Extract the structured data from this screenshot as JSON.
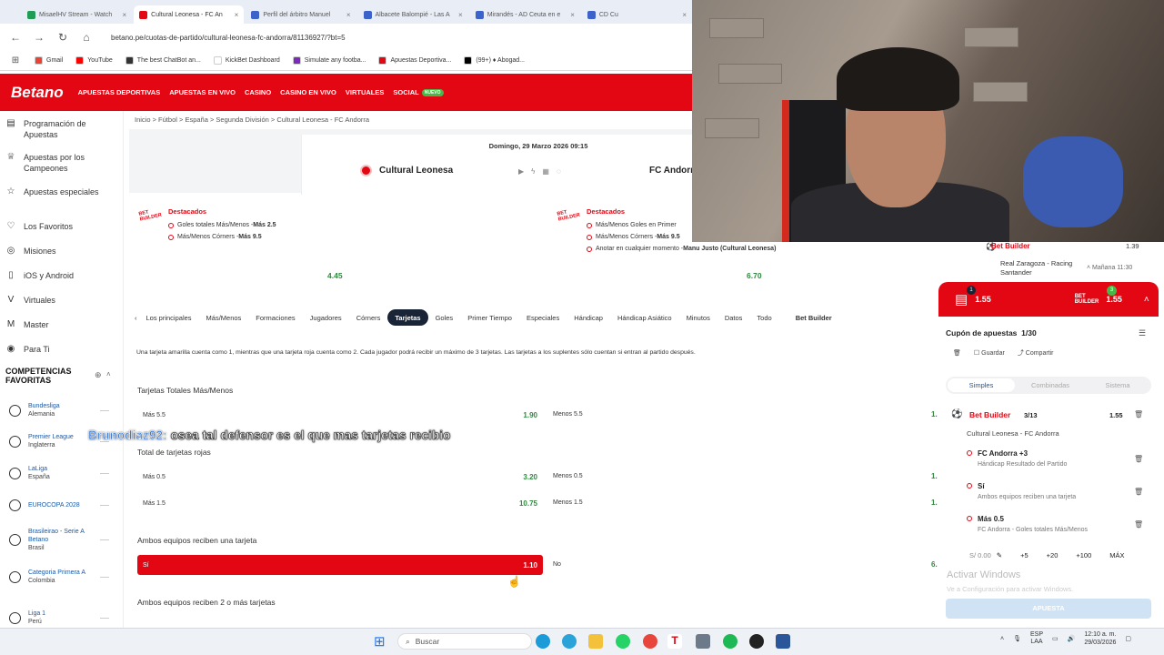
{
  "browser": {
    "tabs": [
      {
        "label": "MisaelHV Stream - Watch",
        "color": "#1f9d55"
      },
      {
        "label": "Cultural Leonesa - FC An",
        "color": "#e30613",
        "active": true
      },
      {
        "label": "Perfil del árbitro Manuel",
        "color": "#3b63c9"
      },
      {
        "label": "Albacete Balompié - Las A",
        "color": "#3b63c9"
      },
      {
        "label": "Mirandés - AD Ceuta en e",
        "color": "#3b63c9"
      },
      {
        "label": "CD Cu",
        "color": "#3b63c9"
      }
    ],
    "url": "betano.pe/cuotas-de-partido/cultural-leonesa-fc-andorra/81136927/?bt=5",
    "bookmarks": [
      {
        "label": "Gmail",
        "color": "#ea4335"
      },
      {
        "label": "YouTube",
        "color": "#ff0000"
      },
      {
        "label": "The best ChatBot an...",
        "color": "#333333"
      },
      {
        "label": "KickBet Dashboard",
        "color": "#ffffff"
      },
      {
        "label": "Simulate any footba...",
        "color": "#7b2bb8"
      },
      {
        "label": "Apuestas Deportiva...",
        "color": "#e30613"
      },
      {
        "label": "(99+) ♦ Abogad...",
        "color": "#000000"
      }
    ]
  },
  "header": {
    "logo": "Betano",
    "nav": [
      "APUESTAS DEPORTIVAS",
      "APUESTAS EN VIVO",
      "CASINO",
      "CASINO EN VIVO",
      "VIRTUALES",
      "SOCIAL"
    ],
    "nuevo": "NUEVO"
  },
  "sidebar": {
    "items": [
      {
        "label": "Programación de Apuestas",
        "icon": "calendar-icon"
      },
      {
        "label": "Apuestas por los Campeones",
        "icon": "trophy-icon"
      },
      {
        "label": "Apuestas especiales",
        "icon": "star-icon"
      },
      {
        "label": "Los Favoritos",
        "icon": "heart-icon"
      },
      {
        "label": "Misiones",
        "icon": "target-icon"
      },
      {
        "label": "iOS y Android",
        "icon": "phone-icon"
      },
      {
        "label": "Virtuales",
        "icon": "virtual-icon"
      },
      {
        "label": "Master",
        "icon": "master-icon"
      },
      {
        "label": "Para Ti",
        "icon": "user-icon"
      }
    ],
    "competitions_title": "COMPETENCIAS FAVORITAS",
    "competitions": [
      {
        "name": "Bundesliga",
        "country": "Alemania"
      },
      {
        "name": "Premier League",
        "country": "Inglaterra"
      },
      {
        "name": "LaLiga",
        "country": "España"
      },
      {
        "name": "EUROCOPA 2028",
        "country": ""
      },
      {
        "name": "Brasileirao - Serie A Betano",
        "country": "Brasil"
      },
      {
        "name": "Categoria Primera A",
        "country": "Colombia"
      },
      {
        "name": "Liga 1",
        "country": "Perú"
      }
    ]
  },
  "breadcrumb": "Inicio > Fútbol > España > Segunda División > Cultural Leonesa - FC Andorra",
  "match": {
    "date": "Domingo, 29 Marzo 2026 09:15",
    "home": "Cultural Leonesa",
    "away": "FC Andorra"
  },
  "featured": [
    {
      "badge": "BET BUILDER",
      "title": "Destacados",
      "lines": [
        {
          "text": "Goles totales Más/Menos - ",
          "bold": "Más 2.5"
        },
        {
          "text": "Más/Menos Córners - ",
          "bold": "Más 9.5"
        }
      ],
      "odds": "4.45"
    },
    {
      "badge": "BET BUILDER",
      "title": "Destacados",
      "lines": [
        {
          "text": "Más/Menos Goles en Primer",
          "bold": ""
        },
        {
          "text": "Más/Menos Córners - ",
          "bold": "Más 9.5"
        },
        {
          "text": "Anotar en cualquier momento - ",
          "bold": "Manu Justo (Cultural Leonesa)"
        }
      ],
      "odds": "6.70"
    }
  ],
  "market_tabs": [
    "Los principales",
    "Más/Menos",
    "Formaciones",
    "Jugadores",
    "Córners",
    "Tarjetas",
    "Goles",
    "Primer Tiempo",
    "Especiales",
    "Hándicap",
    "Hándicap Asiático",
    "Minutos",
    "Datos",
    "Todo",
    "Bet Builder"
  ],
  "notice": "Una tarjeta amarilla cuenta como 1, mientras que una tarjeta roja cuenta como 2. Cada jugador podrá recibir un máximo de 3 tarjetas. Las tarjetas a los suplentes sólo cuentan si entran al partido después.",
  "markets": {
    "totales": {
      "title": "Tarjetas Totales Más/Menos",
      "rows": [
        {
          "label": "Más 5.5",
          "odds": "1.90",
          "alt": "Menos 5.5",
          "alt_odds": "1."
        }
      ]
    },
    "rojas": {
      "title": "Total de tarjetas rojas",
      "rows": [
        {
          "label": "Más 0.5",
          "odds": "3.20",
          "alt": "Menos 0.5",
          "alt_odds": "1."
        },
        {
          "label": "Más 1.5",
          "odds": "10.75",
          "alt": "Menos 1.5",
          "alt_odds": "1."
        }
      ]
    },
    "ambos": {
      "title": "Ambos equipos reciben una tarjeta",
      "rows": [
        {
          "label": "Sí",
          "odds": "1.10",
          "alt": "No",
          "alt_odds": "6."
        }
      ]
    },
    "ambos2": {
      "title": "Ambos equipos reciben 2 o más tarjetas"
    }
  },
  "chat": {
    "user": "Brunodiaz92:",
    "message": " osea tal defensor es el que mas tarjetas recibio"
  },
  "bet_builder_top": {
    "label": "Bet Builder",
    "odds": "1.39",
    "match": "Real Zaragoza - Racing Santander",
    "time": "Mañana 11:30"
  },
  "slip": {
    "count": "1",
    "odds": "1.55",
    "bb_odds": "1.55",
    "bb_count": "3",
    "title": "Cupón de apuestas",
    "title_count": "1/30",
    "tools": [
      "Guardar",
      "Compartir"
    ],
    "tabs": [
      "Simples",
      "Combinadas",
      "Sistema"
    ],
    "bb_label": "Bet Builder",
    "bb_fraction": "3/13",
    "bb_total": "1.55",
    "match": "Cultural Leonesa - FC Andorra",
    "selections": [
      {
        "pick": "FC Andorra +3",
        "market": "Hándicap Resultado del Partido"
      },
      {
        "pick": "Sí",
        "market": "Ambos equipos reciben una tarjeta"
      },
      {
        "pick": "Más 0.5",
        "market": "FC Andorra - Goles totales Más/Menos"
      }
    ],
    "stake": "S/ 0.00",
    "quick": [
      "+5",
      "+20",
      "+100",
      "MÁX"
    ],
    "watermark": "Activar Windows",
    "watermark_sub": "Ve a Configuración para activar Windows.",
    "bet_button": "APUESTA"
  },
  "taskbar": {
    "search": "Buscar",
    "lang": "ESP",
    "lang_sub": "LAA",
    "time": "12:10 a. m.",
    "date": "29/03/2026"
  }
}
